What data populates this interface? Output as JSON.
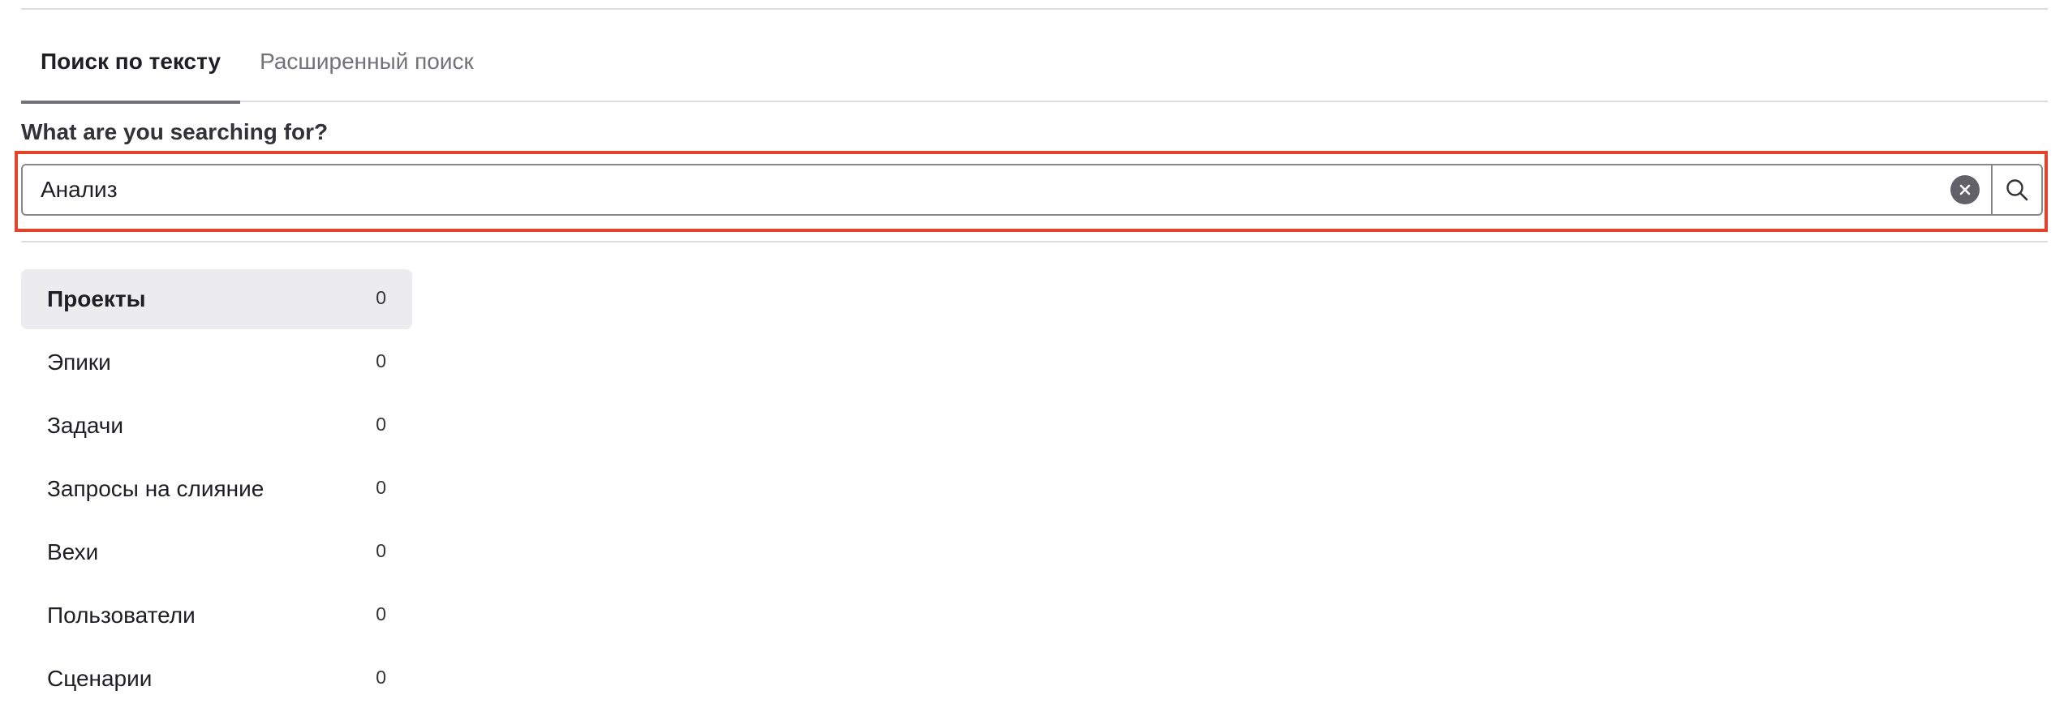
{
  "tabs": [
    {
      "label": "Поиск по тексту",
      "active": true
    },
    {
      "label": "Расширенный поиск",
      "active": false
    }
  ],
  "search": {
    "label": "What are you searching for?",
    "value": "Анализ",
    "clear_icon": "clear-circle-icon",
    "submit_icon": "search-icon"
  },
  "highlight_color": "#e24329",
  "scopes": [
    {
      "label": "Проекты",
      "count": "0",
      "active": true
    },
    {
      "label": "Эпики",
      "count": "0",
      "active": false
    },
    {
      "label": "Задачи",
      "count": "0",
      "active": false
    },
    {
      "label": "Запросы на слияние",
      "count": "0",
      "active": false
    },
    {
      "label": "Вехи",
      "count": "0",
      "active": false
    },
    {
      "label": "Пользователи",
      "count": "0",
      "active": false
    },
    {
      "label": "Сценарии",
      "count": "0",
      "active": false
    }
  ]
}
